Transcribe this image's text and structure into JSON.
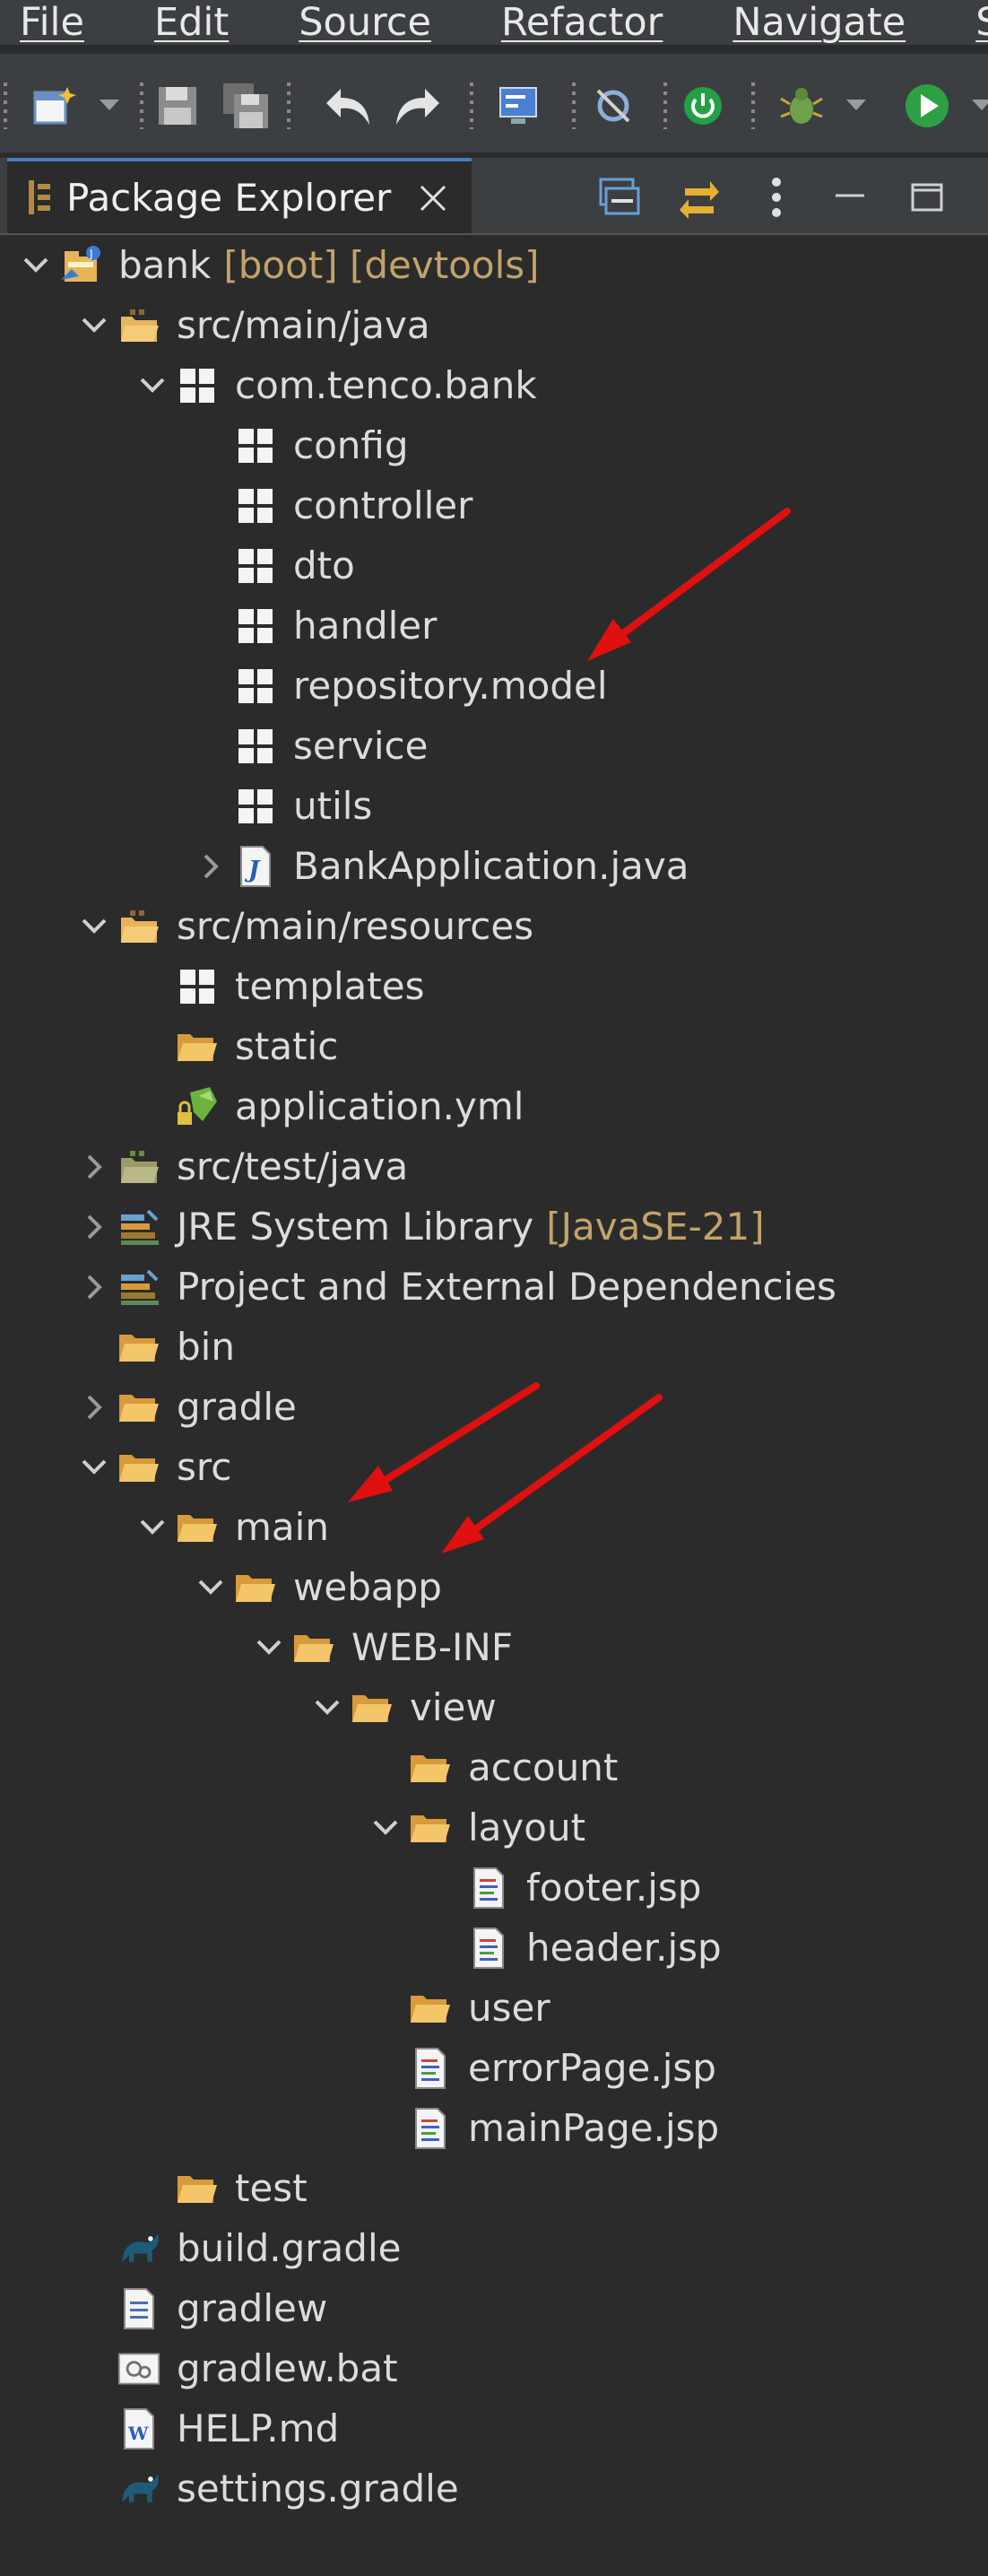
{
  "menu": [
    "File",
    "Edit",
    "Source",
    "Refactor",
    "Navigate",
    "Sea"
  ],
  "view": {
    "title": "Package Explorer"
  },
  "tree": [
    {
      "label": "bank",
      "deco": "[boot] [devtools]",
      "depth": 0,
      "twisty": "open",
      "icon": "project-icon"
    },
    {
      "label": "src/main/java",
      "depth": 1,
      "twisty": "open",
      "icon": "source-folder-icon"
    },
    {
      "label": "com.tenco.bank",
      "depth": 2,
      "twisty": "open",
      "icon": "package-icon"
    },
    {
      "label": "config",
      "depth": 3,
      "twisty": "none",
      "icon": "package-icon"
    },
    {
      "label": "controller",
      "depth": 3,
      "twisty": "none",
      "icon": "package-icon"
    },
    {
      "label": "dto",
      "depth": 3,
      "twisty": "none",
      "icon": "package-icon"
    },
    {
      "label": "handler",
      "depth": 3,
      "twisty": "none",
      "icon": "package-icon"
    },
    {
      "label": "repository.model",
      "depth": 3,
      "twisty": "none",
      "icon": "package-icon"
    },
    {
      "label": "service",
      "depth": 3,
      "twisty": "none",
      "icon": "package-icon"
    },
    {
      "label": "utils",
      "depth": 3,
      "twisty": "none",
      "icon": "package-icon"
    },
    {
      "label": "BankApplication.java",
      "depth": 3,
      "twisty": "closed",
      "icon": "java-file-icon"
    },
    {
      "label": "src/main/resources",
      "depth": 1,
      "twisty": "open",
      "icon": "source-folder-icon"
    },
    {
      "label": "templates",
      "depth": 2,
      "twisty": "none",
      "icon": "package-icon"
    },
    {
      "label": "static",
      "depth": 2,
      "twisty": "none",
      "icon": "folder-icon"
    },
    {
      "label": "application.yml",
      "depth": 2,
      "twisty": "none",
      "icon": "yml-file-icon"
    },
    {
      "label": "src/test/java",
      "depth": 1,
      "twisty": "closed",
      "icon": "test-folder-icon"
    },
    {
      "label": "JRE System Library",
      "deco": "[JavaSE-21]",
      "depth": 1,
      "twisty": "closed",
      "icon": "library-icon"
    },
    {
      "label": "Project and External Dependencies",
      "depth": 1,
      "twisty": "closed",
      "icon": "library-icon"
    },
    {
      "label": "bin",
      "depth": 1,
      "twisty": "none",
      "icon": "folder-icon"
    },
    {
      "label": "gradle",
      "depth": 1,
      "twisty": "closed",
      "icon": "folder-icon"
    },
    {
      "label": "src",
      "depth": 1,
      "twisty": "open",
      "icon": "folder-icon"
    },
    {
      "label": "main",
      "depth": 2,
      "twisty": "open",
      "icon": "folder-icon"
    },
    {
      "label": "webapp",
      "depth": 3,
      "twisty": "open",
      "icon": "folder-icon"
    },
    {
      "label": "WEB-INF",
      "depth": 4,
      "twisty": "open",
      "icon": "folder-icon"
    },
    {
      "label": "view",
      "depth": 5,
      "twisty": "open",
      "icon": "folder-icon"
    },
    {
      "label": "account",
      "depth": 6,
      "twisty": "none",
      "icon": "folder-icon"
    },
    {
      "label": "layout",
      "depth": 6,
      "twisty": "open",
      "icon": "folder-icon"
    },
    {
      "label": "footer.jsp",
      "depth": 7,
      "twisty": "none",
      "icon": "jsp-file-icon"
    },
    {
      "label": "header.jsp",
      "depth": 7,
      "twisty": "none",
      "icon": "jsp-file-icon"
    },
    {
      "label": "user",
      "depth": 6,
      "twisty": "none",
      "icon": "folder-icon"
    },
    {
      "label": "errorPage.jsp",
      "depth": 6,
      "twisty": "none",
      "icon": "jsp-file-icon"
    },
    {
      "label": "mainPage.jsp",
      "depth": 6,
      "twisty": "none",
      "icon": "jsp-file-icon"
    },
    {
      "label": "test",
      "depth": 2,
      "twisty": "none",
      "icon": "folder-icon"
    },
    {
      "label": "build.gradle",
      "depth": 1,
      "twisty": "none",
      "icon": "gradle-file-icon"
    },
    {
      "label": "gradlew",
      "depth": 1,
      "twisty": "none",
      "icon": "text-file-icon"
    },
    {
      "label": "gradlew.bat",
      "depth": 1,
      "twisty": "none",
      "icon": "bat-file-icon"
    },
    {
      "label": "HELP.md",
      "depth": 1,
      "twisty": "none",
      "icon": "md-file-icon"
    },
    {
      "label": "settings.gradle",
      "depth": 1,
      "twisty": "none",
      "icon": "gradle-file-icon"
    }
  ],
  "colors": {
    "background": "#2b2b2b",
    "deco": "#c2a36a",
    "annotation_arrow": "#e01010",
    "folder": "#e8b45a"
  }
}
